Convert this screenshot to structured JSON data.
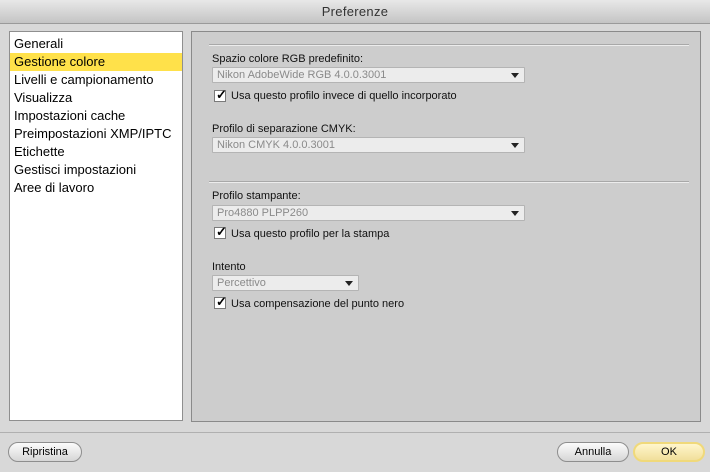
{
  "window": {
    "title": "Preferenze"
  },
  "sidebar": {
    "items": [
      {
        "label": "Generali"
      },
      {
        "label": "Gestione colore",
        "selected": true
      },
      {
        "label": "Livelli e campionamento"
      },
      {
        "label": "Visualizza"
      },
      {
        "label": "Impostazioni cache"
      },
      {
        "label": "Preimpostazioni XMP/IPTC"
      },
      {
        "label": "Etichette"
      },
      {
        "label": "Gestisci impostazioni"
      },
      {
        "label": "Aree di lavoro"
      }
    ]
  },
  "rgb": {
    "label": "Spazio colore RGB predefinito:",
    "value": "Nikon AdobeWide RGB 4.0.0.3001",
    "checkbox_label": "Usa questo profilo invece di quello incorporato",
    "checked": true
  },
  "cmyk": {
    "label": "Profilo di separazione CMYK:",
    "value": "Nikon CMYK 4.0.0.3001"
  },
  "printer": {
    "label": "Profilo stampante:",
    "value": "Pro4880 PLPP260",
    "checkbox_label": "Usa questo profilo per la stampa",
    "checked": true
  },
  "intent": {
    "label": "Intento",
    "value": "Percettivo",
    "checkbox_label": "Usa compensazione del punto nero",
    "checked": true
  },
  "buttons": {
    "reset": "Ripristina",
    "cancel": "Annulla",
    "ok": "OK"
  },
  "colors": {
    "selection": "#ffe14a",
    "panel": "#cdcdcd",
    "window": "#d8d8d8",
    "default_button": "#f1df9b"
  }
}
